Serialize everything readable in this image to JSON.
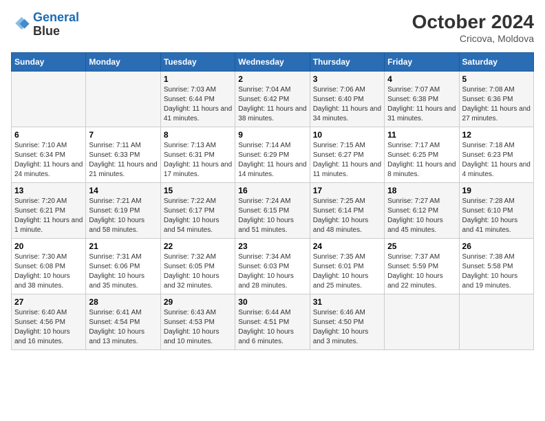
{
  "header": {
    "logo_line1": "General",
    "logo_line2": "Blue",
    "month_title": "October 2024",
    "subtitle": "Cricova, Moldova"
  },
  "days_of_week": [
    "Sunday",
    "Monday",
    "Tuesday",
    "Wednesday",
    "Thursday",
    "Friday",
    "Saturday"
  ],
  "weeks": [
    [
      {
        "day": "",
        "info": ""
      },
      {
        "day": "",
        "info": ""
      },
      {
        "day": "1",
        "info": "Sunrise: 7:03 AM\nSunset: 6:44 PM\nDaylight: 11 hours and 41 minutes."
      },
      {
        "day": "2",
        "info": "Sunrise: 7:04 AM\nSunset: 6:42 PM\nDaylight: 11 hours and 38 minutes."
      },
      {
        "day": "3",
        "info": "Sunrise: 7:06 AM\nSunset: 6:40 PM\nDaylight: 11 hours and 34 minutes."
      },
      {
        "day": "4",
        "info": "Sunrise: 7:07 AM\nSunset: 6:38 PM\nDaylight: 11 hours and 31 minutes."
      },
      {
        "day": "5",
        "info": "Sunrise: 7:08 AM\nSunset: 6:36 PM\nDaylight: 11 hours and 27 minutes."
      }
    ],
    [
      {
        "day": "6",
        "info": "Sunrise: 7:10 AM\nSunset: 6:34 PM\nDaylight: 11 hours and 24 minutes."
      },
      {
        "day": "7",
        "info": "Sunrise: 7:11 AM\nSunset: 6:33 PM\nDaylight: 11 hours and 21 minutes."
      },
      {
        "day": "8",
        "info": "Sunrise: 7:13 AM\nSunset: 6:31 PM\nDaylight: 11 hours and 17 minutes."
      },
      {
        "day": "9",
        "info": "Sunrise: 7:14 AM\nSunset: 6:29 PM\nDaylight: 11 hours and 14 minutes."
      },
      {
        "day": "10",
        "info": "Sunrise: 7:15 AM\nSunset: 6:27 PM\nDaylight: 11 hours and 11 minutes."
      },
      {
        "day": "11",
        "info": "Sunrise: 7:17 AM\nSunset: 6:25 PM\nDaylight: 11 hours and 8 minutes."
      },
      {
        "day": "12",
        "info": "Sunrise: 7:18 AM\nSunset: 6:23 PM\nDaylight: 11 hours and 4 minutes."
      }
    ],
    [
      {
        "day": "13",
        "info": "Sunrise: 7:20 AM\nSunset: 6:21 PM\nDaylight: 11 hours and 1 minute."
      },
      {
        "day": "14",
        "info": "Sunrise: 7:21 AM\nSunset: 6:19 PM\nDaylight: 10 hours and 58 minutes."
      },
      {
        "day": "15",
        "info": "Sunrise: 7:22 AM\nSunset: 6:17 PM\nDaylight: 10 hours and 54 minutes."
      },
      {
        "day": "16",
        "info": "Sunrise: 7:24 AM\nSunset: 6:15 PM\nDaylight: 10 hours and 51 minutes."
      },
      {
        "day": "17",
        "info": "Sunrise: 7:25 AM\nSunset: 6:14 PM\nDaylight: 10 hours and 48 minutes."
      },
      {
        "day": "18",
        "info": "Sunrise: 7:27 AM\nSunset: 6:12 PM\nDaylight: 10 hours and 45 minutes."
      },
      {
        "day": "19",
        "info": "Sunrise: 7:28 AM\nSunset: 6:10 PM\nDaylight: 10 hours and 41 minutes."
      }
    ],
    [
      {
        "day": "20",
        "info": "Sunrise: 7:30 AM\nSunset: 6:08 PM\nDaylight: 10 hours and 38 minutes."
      },
      {
        "day": "21",
        "info": "Sunrise: 7:31 AM\nSunset: 6:06 PM\nDaylight: 10 hours and 35 minutes."
      },
      {
        "day": "22",
        "info": "Sunrise: 7:32 AM\nSunset: 6:05 PM\nDaylight: 10 hours and 32 minutes."
      },
      {
        "day": "23",
        "info": "Sunrise: 7:34 AM\nSunset: 6:03 PM\nDaylight: 10 hours and 28 minutes."
      },
      {
        "day": "24",
        "info": "Sunrise: 7:35 AM\nSunset: 6:01 PM\nDaylight: 10 hours and 25 minutes."
      },
      {
        "day": "25",
        "info": "Sunrise: 7:37 AM\nSunset: 5:59 PM\nDaylight: 10 hours and 22 minutes."
      },
      {
        "day": "26",
        "info": "Sunrise: 7:38 AM\nSunset: 5:58 PM\nDaylight: 10 hours and 19 minutes."
      }
    ],
    [
      {
        "day": "27",
        "info": "Sunrise: 6:40 AM\nSunset: 4:56 PM\nDaylight: 10 hours and 16 minutes."
      },
      {
        "day": "28",
        "info": "Sunrise: 6:41 AM\nSunset: 4:54 PM\nDaylight: 10 hours and 13 minutes."
      },
      {
        "day": "29",
        "info": "Sunrise: 6:43 AM\nSunset: 4:53 PM\nDaylight: 10 hours and 10 minutes."
      },
      {
        "day": "30",
        "info": "Sunrise: 6:44 AM\nSunset: 4:51 PM\nDaylight: 10 hours and 6 minutes."
      },
      {
        "day": "31",
        "info": "Sunrise: 6:46 AM\nSunset: 4:50 PM\nDaylight: 10 hours and 3 minutes."
      },
      {
        "day": "",
        "info": ""
      },
      {
        "day": "",
        "info": ""
      }
    ]
  ]
}
